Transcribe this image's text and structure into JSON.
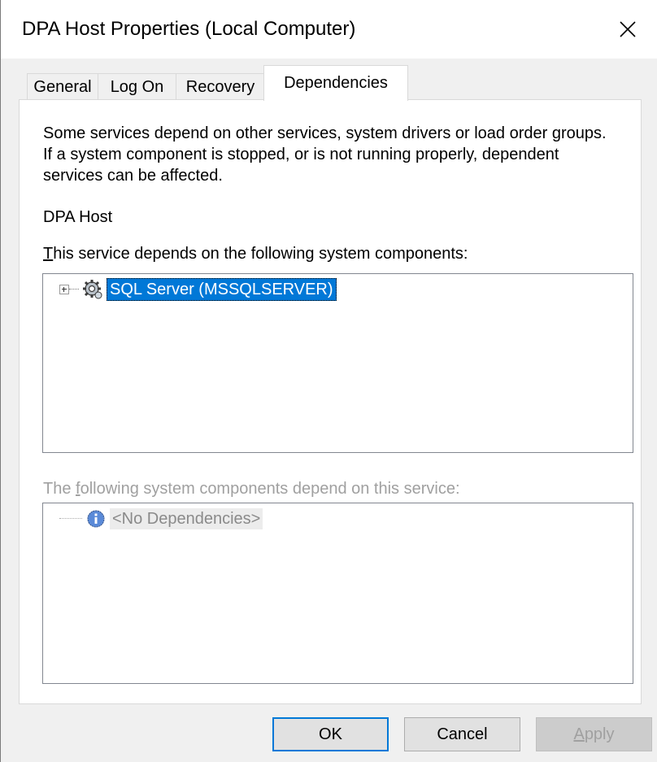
{
  "window": {
    "title": "DPA Host Properties (Local Computer)"
  },
  "tabs": [
    {
      "label": "General"
    },
    {
      "label": "Log On"
    },
    {
      "label": "Recovery"
    },
    {
      "label": "Dependencies",
      "active": true
    }
  ],
  "panel": {
    "description": "Some services depend on other services, system drivers or load order groups. If a system component is stopped, or is not running properly, dependent services can be affected.",
    "service_name": "DPA Host",
    "depends_on_label_mnemonic": "T",
    "depends_on_label_rest": "his service depends on the following system components:",
    "depends_on_items": [
      {
        "label": "SQL Server (MSSQLSERVER)",
        "icon": "gear-icon",
        "selected": true,
        "expandable": true
      }
    ],
    "dependents_label_pre": "The ",
    "dependents_label_mnemonic": "f",
    "dependents_label_rest": "ollowing system components depend on this service:",
    "dependents_items": [
      {
        "label": "<No Dependencies>",
        "icon": "info-icon"
      }
    ]
  },
  "buttons": {
    "ok": "OK",
    "cancel": "Cancel",
    "apply_mnemonic": "A",
    "apply_rest": "pply"
  },
  "colors": {
    "selection": "#0078d7",
    "disabled_text": "#a0a0a0"
  }
}
